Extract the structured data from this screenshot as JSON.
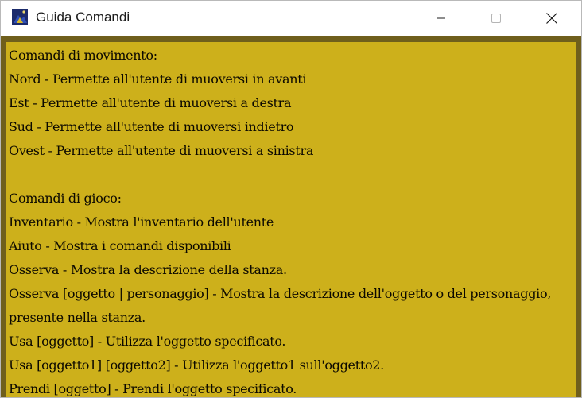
{
  "window": {
    "title": "Guida Comandi",
    "icon": "game-app-icon",
    "controls": {
      "minimize": "minimize-icon",
      "maximize": "maximize-icon",
      "close": "close-icon"
    }
  },
  "colors": {
    "frame": "#6f5f1c",
    "panel": "#cdb01b",
    "text": "#0c0900"
  },
  "help": {
    "lines": [
      "Comandi di movimento:",
      "Nord - Permette all'utente di muoversi in avanti",
      "Est - Permette all'utente di muoversi a destra",
      "Sud - Permette all'utente di muoversi indietro",
      "Ovest - Permette all'utente di muoversi a sinistra",
      "",
      "Comandi di gioco:",
      "Inventario - Mostra l'inventario dell'utente",
      "Aiuto - Mostra i comandi disponibili",
      "Osserva - Mostra la descrizione della stanza.",
      "Osserva [oggetto | personaggio] - Mostra la descrizione dell'oggetto o del personaggio,",
      "presente nella stanza.",
      "Usa [oggetto] - Utilizza l'oggetto specificato.",
      "Usa [oggetto1] [oggetto2] - Utilizza l'oggetto1 sull'oggetto2.",
      "Prendi [oggetto] - Prendi l'oggetto specificato."
    ]
  }
}
